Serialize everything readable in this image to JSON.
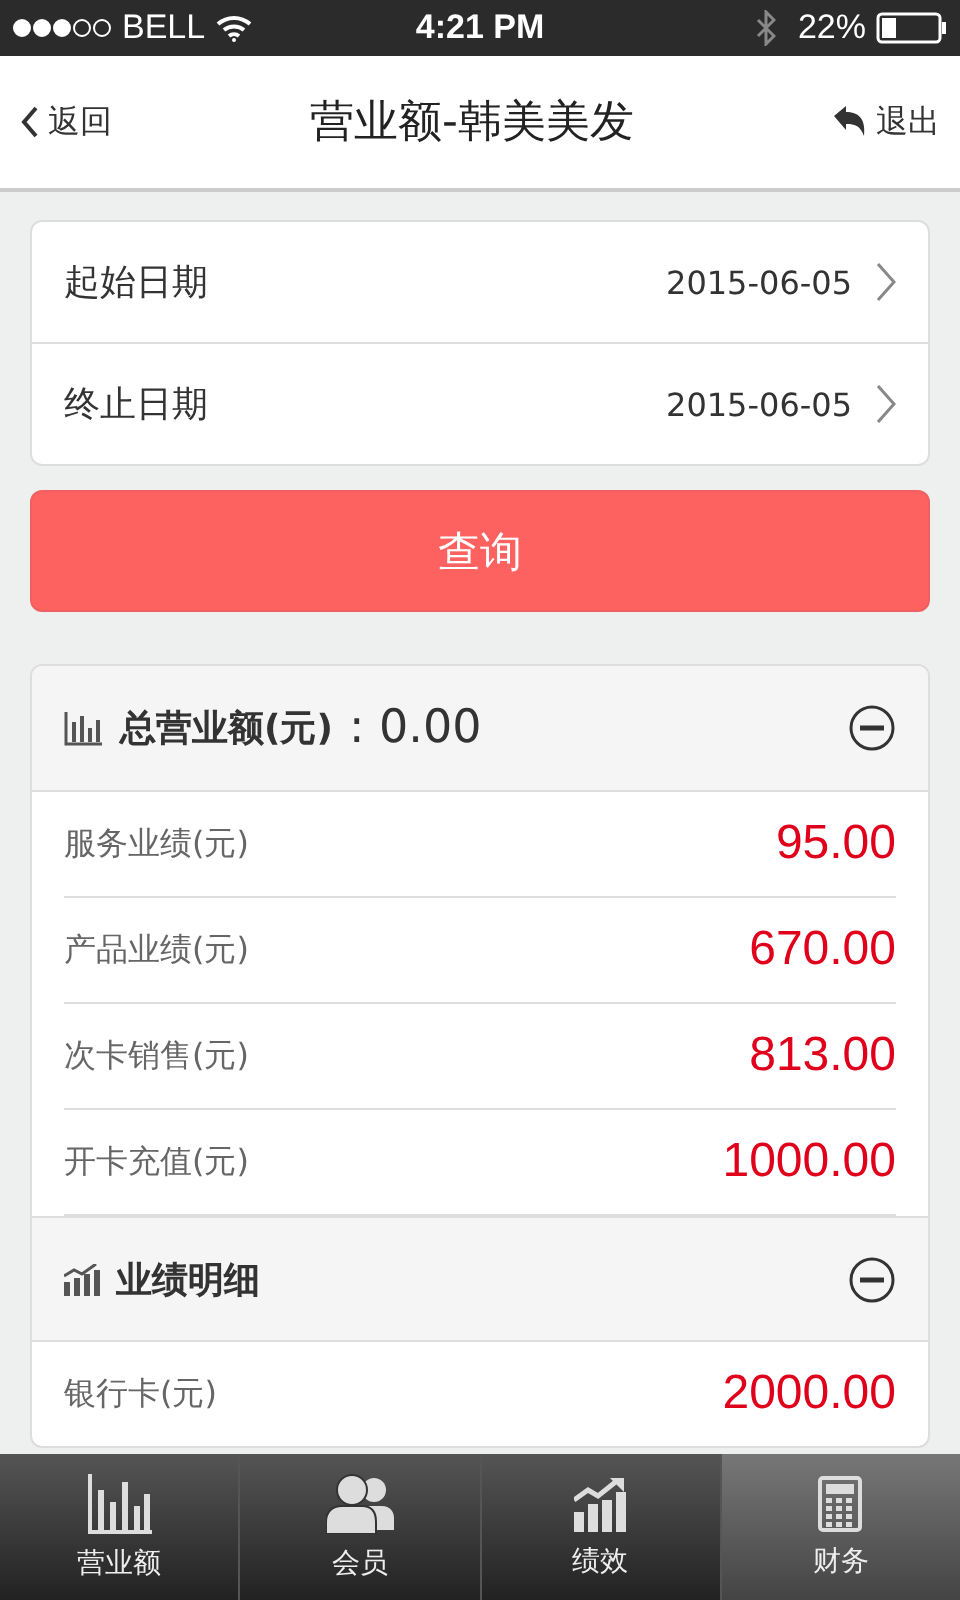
{
  "status_bar": {
    "carrier": "BELL",
    "time": "4:21 PM",
    "battery": "22%"
  },
  "nav": {
    "back": "返回",
    "title": "营业额-韩美美发",
    "exit": "退出"
  },
  "dates": [
    {
      "label": "起始日期",
      "value": "2015-06-05"
    },
    {
      "label": "终止日期",
      "value": "2015-06-05"
    }
  ],
  "query_button": "查询",
  "sections": [
    {
      "kind": "total",
      "title": "总营业额(元)",
      "value": ": 0.00",
      "expanded": true,
      "rows": [
        {
          "label": "服务业绩(元)",
          "value": "95.00"
        },
        {
          "label": "产品业绩(元)",
          "value": "670.00"
        },
        {
          "label": "次卡销售(元)",
          "value": "813.00"
        },
        {
          "label": "开卡充值(元)",
          "value": "1000.00"
        }
      ]
    },
    {
      "kind": "detail",
      "title": "业绩明细",
      "expanded": true,
      "rows": [
        {
          "label": "银行卡(元)",
          "value": "2000.00"
        }
      ]
    }
  ],
  "tab_bar": [
    {
      "kind": "bars",
      "label": "营业额",
      "selected": false
    },
    {
      "kind": "members",
      "label": "会员",
      "selected": false
    },
    {
      "kind": "trend",
      "label": "绩效",
      "selected": false
    },
    {
      "kind": "calculator",
      "label": "财务",
      "selected": true
    }
  ]
}
